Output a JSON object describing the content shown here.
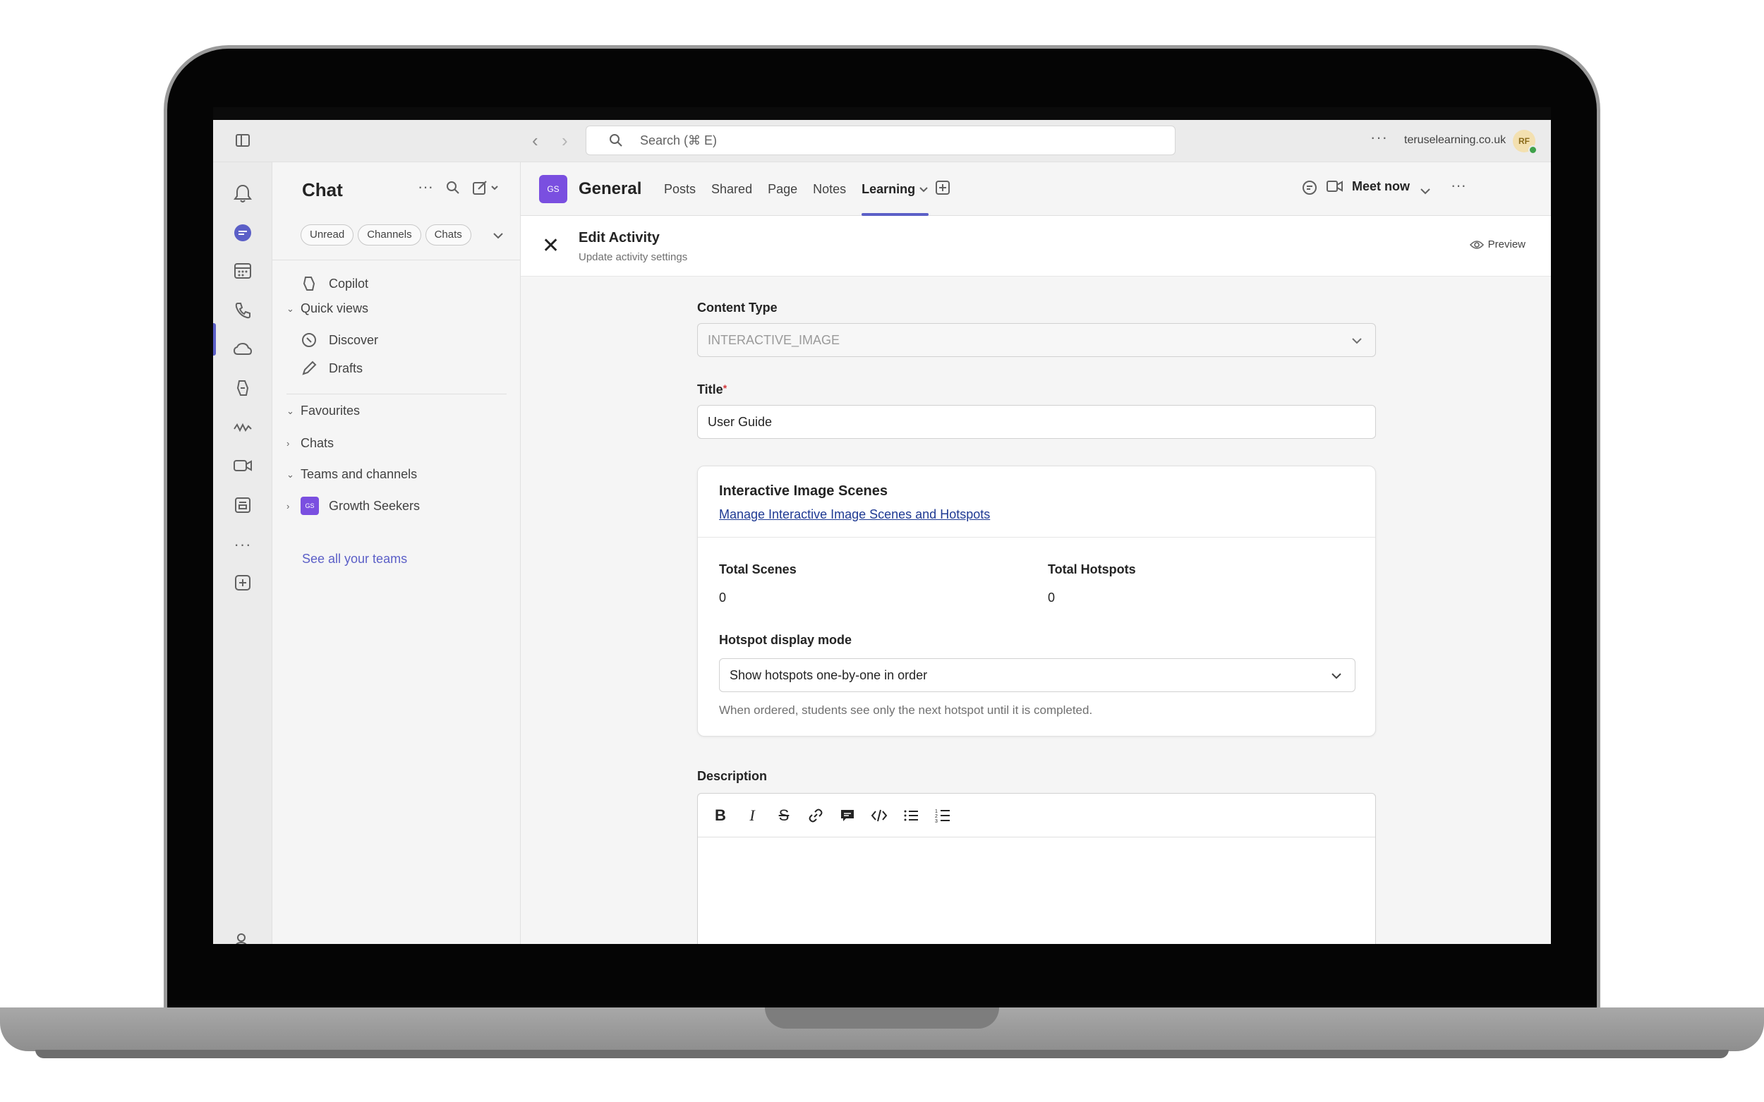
{
  "titlebar": {
    "search_placeholder": "Search (⌘ E)",
    "more": "···",
    "org": "teruselearning.co.uk",
    "avatar_initials": "RF"
  },
  "chat_panel": {
    "title": "Chat",
    "filters": [
      "Unread",
      "Channels",
      "Chats"
    ],
    "copilot": "Copilot",
    "quick_views": "Quick views",
    "discover": "Discover",
    "drafts": "Drafts",
    "favourites": "Favourites",
    "chats": "Chats",
    "teams_and_channels": "Teams and channels",
    "team_name": "Growth Seekers",
    "team_initials": "GS",
    "see_all": "See all your teams"
  },
  "channel": {
    "initials": "GS",
    "name": "General",
    "tabs": [
      "Posts",
      "Shared",
      "Page",
      "Notes",
      "Learning"
    ],
    "active_tab": "Learning",
    "meet_now": "Meet now",
    "more": "···"
  },
  "activity": {
    "title": "Edit Activity",
    "subtitle": "Update activity settings",
    "preview": "Preview"
  },
  "form": {
    "content_type_label": "Content Type",
    "content_type_value": "INTERACTIVE_IMAGE",
    "title_label": "Title",
    "title_required": "*",
    "title_value": "User Guide",
    "card": {
      "title": "Interactive Image Scenes",
      "link": "Manage Interactive Image Scenes and Hotspots",
      "total_scenes_label": "Total Scenes",
      "total_scenes_value": "0",
      "total_hotspots_label": "Total Hotspots",
      "total_hotspots_value": "0",
      "mode_label": "Hotspot display mode",
      "mode_value": "Show hotspots one-by-one in order",
      "mode_help": "When ordered, students see only the next hotspot until it is completed."
    },
    "description_label": "Description"
  },
  "colors": {
    "accent": "#5b5fc7",
    "team_badge": "#7a4fe0",
    "link": "#1f3a93",
    "required": "#d13438"
  }
}
